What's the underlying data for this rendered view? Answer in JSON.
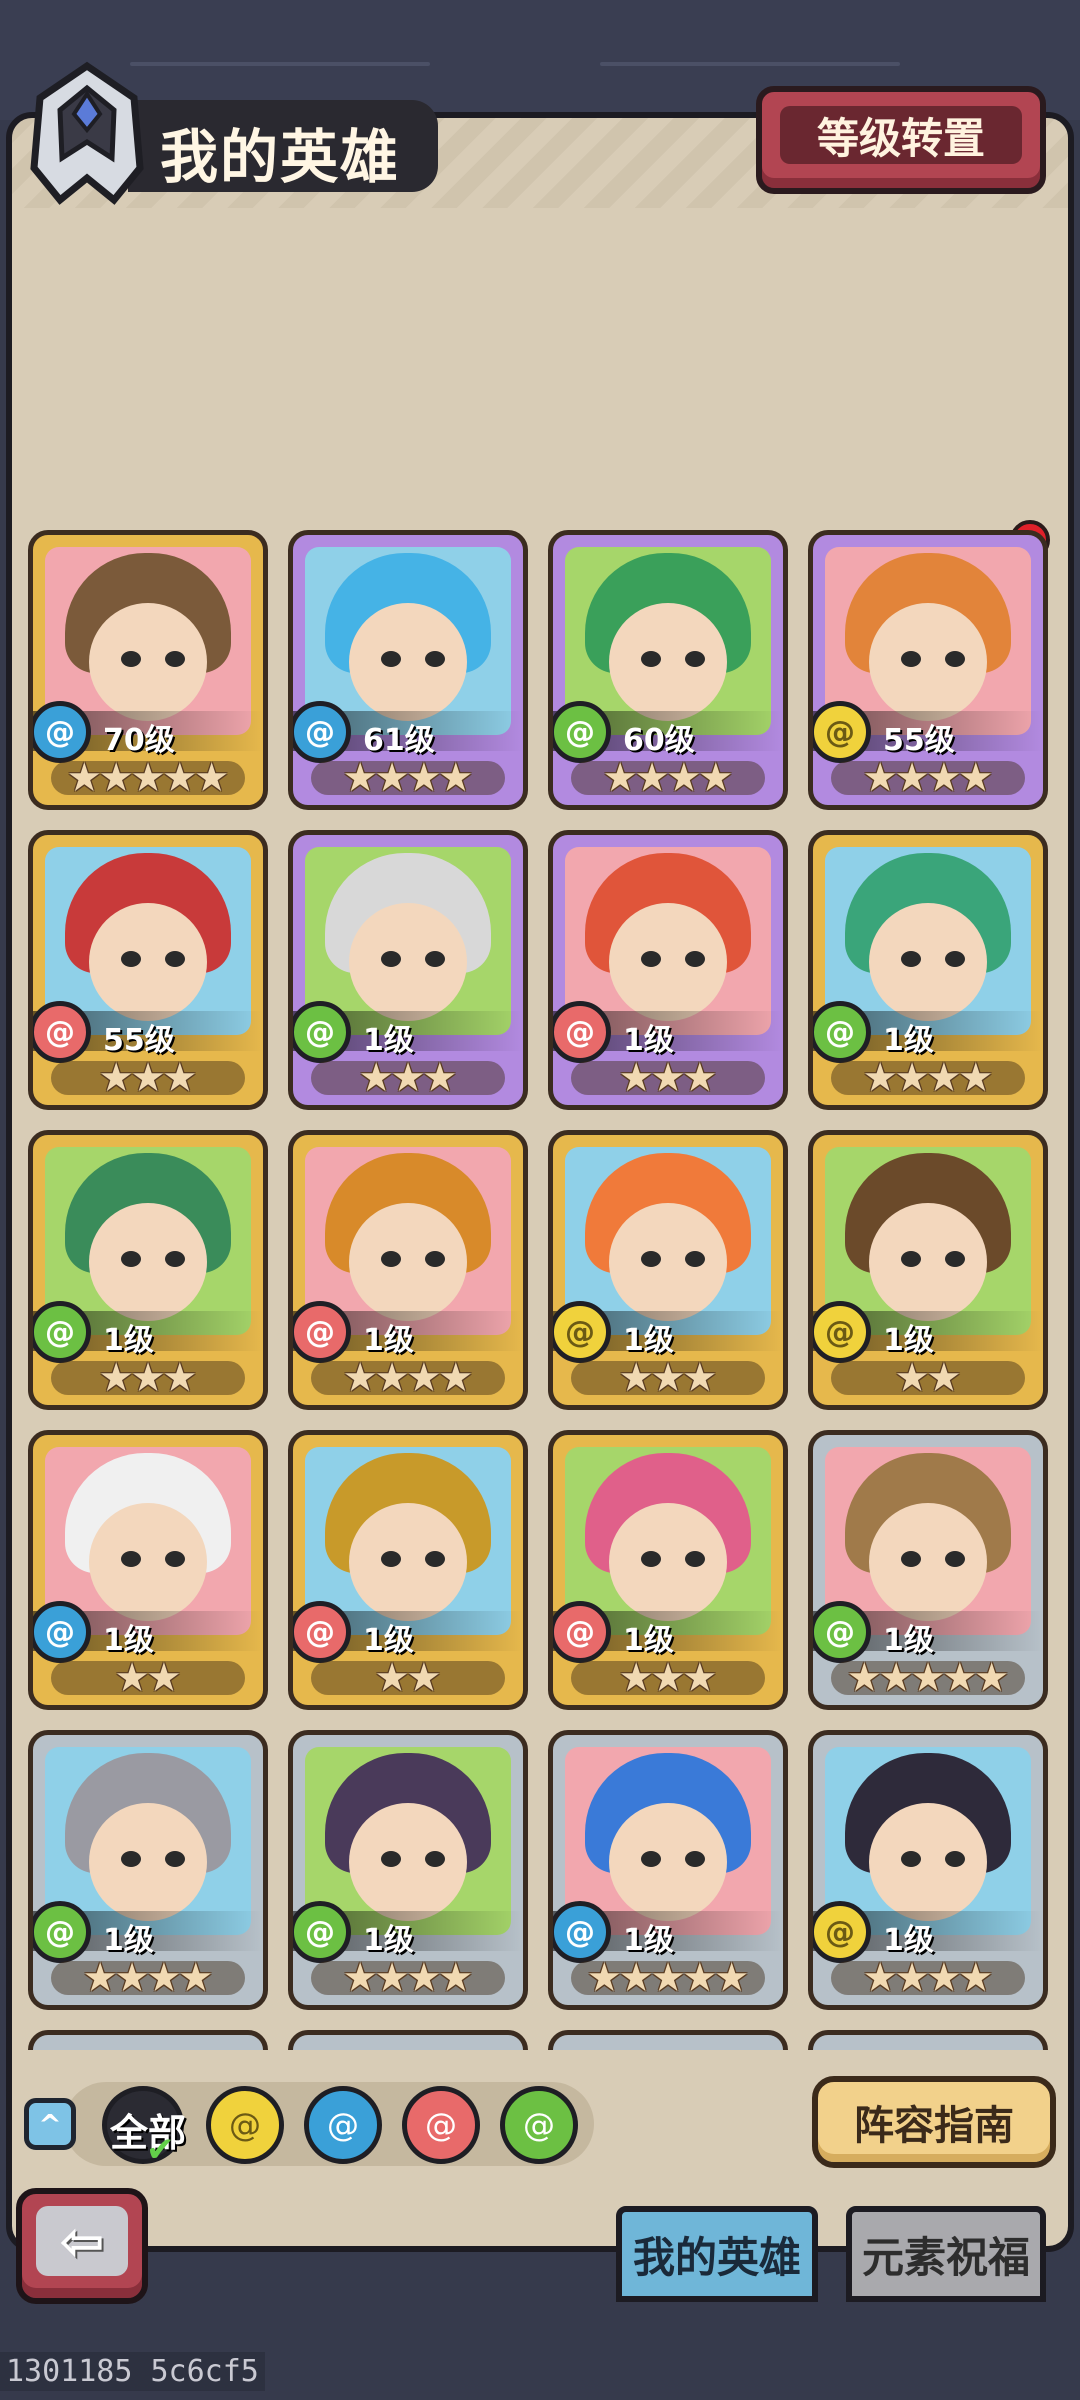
{
  "header": {
    "title": "我的英雄",
    "reset_button": "等级转置"
  },
  "heroes": [
    {
      "level": "70级",
      "element": "water",
      "stars": 5,
      "frame": "gold",
      "hair": "#7b5a3a"
    },
    {
      "level": "61级",
      "element": "water",
      "stars": 4,
      "frame": "purple",
      "hair": "#45b3e6"
    },
    {
      "level": "60级",
      "element": "wind",
      "stars": 4,
      "frame": "purple",
      "hair": "#3aa05a"
    },
    {
      "level": "55级",
      "element": "earth",
      "stars": 4,
      "frame": "purple",
      "hair": "#e2843a"
    },
    {
      "level": "55级",
      "element": "fire",
      "stars": 3,
      "frame": "gold",
      "hair": "#c83a3a"
    },
    {
      "level": "1级",
      "element": "wind",
      "stars": 3,
      "frame": "purple",
      "hair": "#d8d8d8"
    },
    {
      "level": "1级",
      "element": "fire",
      "stars": 3,
      "frame": "purple",
      "hair": "#e0553a"
    },
    {
      "level": "1级",
      "element": "wind",
      "stars": 4,
      "frame": "gold",
      "hair": "#3aa57a"
    },
    {
      "level": "1级",
      "element": "wind",
      "stars": 3,
      "frame": "gold",
      "hair": "#3a8c5a"
    },
    {
      "level": "1级",
      "element": "fire",
      "stars": 4,
      "frame": "gold",
      "hair": "#d88a2a"
    },
    {
      "level": "1级",
      "element": "earth",
      "stars": 3,
      "frame": "gold",
      "hair": "#f07a3a"
    },
    {
      "level": "1级",
      "element": "earth",
      "stars": 2,
      "frame": "gold",
      "hair": "#6b4a2a"
    },
    {
      "level": "1级",
      "element": "water",
      "stars": 2,
      "frame": "gold",
      "hair": "#f0f0f0"
    },
    {
      "level": "1级",
      "element": "fire",
      "stars": 2,
      "frame": "gold",
      "hair": "#c89a2a"
    },
    {
      "level": "1级",
      "element": "fire",
      "stars": 3,
      "frame": "gold",
      "hair": "#e0608a"
    },
    {
      "level": "1级",
      "element": "wind",
      "stars": 5,
      "frame": "silver",
      "hair": "#a07a4a"
    },
    {
      "level": "1级",
      "element": "wind",
      "stars": 4,
      "frame": "silver",
      "hair": "#9a9aa2"
    },
    {
      "level": "1级",
      "element": "wind",
      "stars": 4,
      "frame": "silver",
      "hair": "#4a3a5a"
    },
    {
      "level": "1级",
      "element": "water",
      "stars": 5,
      "frame": "silver",
      "hair": "#3a7ad8"
    },
    {
      "level": "1级",
      "element": "earth",
      "stars": 4,
      "frame": "silver",
      "hair": "#2e2a3a"
    }
  ],
  "filters": {
    "all_label": "全部",
    "elements": [
      "earth",
      "water",
      "fire",
      "wind"
    ]
  },
  "guide_button": "阵容指南",
  "tabs": {
    "my_heroes": "我的英雄",
    "element_blessing": "元素祝福"
  },
  "watermark": "1301185 5c6cf5"
}
